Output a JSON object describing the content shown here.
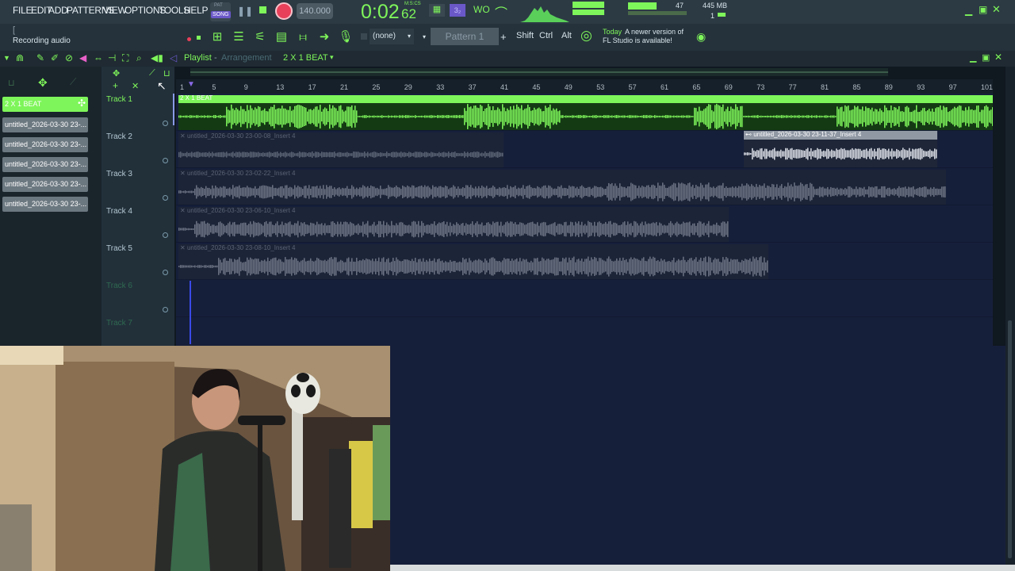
{
  "menu": [
    "FILE",
    "EDIT",
    "ADD",
    "PATTERNS",
    "VIEW",
    "OPTIONS",
    "TOOLS",
    "HELP"
  ],
  "transport": {
    "mode_top": "PAT",
    "mode_bottom": "SONG",
    "tempo": "140.000",
    "time": "0:02",
    "time_sub": "62",
    "time_label": "M:S:CS",
    "pattern_label": "Pattern 1",
    "snap_value": "(none)",
    "cpu": "47",
    "memory": "445 MB",
    "voices": "1"
  },
  "status": {
    "hint_top": "[",
    "hint_text": "Recording audio",
    "news_day": "Today",
    "news_text_1": "A newer version of",
    "news_text_2": "FL Studio is available!"
  },
  "keys": [
    "Shift",
    "Ctrl",
    "Alt"
  ],
  "playlist": {
    "title": "Playlist",
    "subtitle": "Arrangement",
    "pattern": "2 X 1 BEAT"
  },
  "pattern_list": [
    "2 X 1 BEAT",
    "untitled_2026-03-30 23-...",
    "untitled_2026-03-30 23-...",
    "untitled_2026-03-30 23-...",
    "untitled_2026-03-30 23-...",
    "untitled_2026-03-30 23-..."
  ],
  "tracks": [
    "Track 1",
    "Track 2",
    "Track 3",
    "Track 4",
    "Track 5",
    "Track 6",
    "Track 7"
  ],
  "ruler": [
    "1",
    "5",
    "9",
    "13",
    "17",
    "21",
    "25",
    "29",
    "33",
    "37",
    "41",
    "45",
    "49",
    "53",
    "57",
    "61",
    "65",
    "69",
    "73",
    "77",
    "81",
    "85",
    "89",
    "93",
    "97",
    "101"
  ],
  "clips": {
    "beat": "2 X 1 BEAT",
    "t2a": "untitled_2026-03-30 23-00-08_Insert 4",
    "t2b": "untitled_2026-03-30 23-11-37_Insert 4",
    "t3": "untitled_2026-03-30 23-02-22_Insert 4",
    "t4": "untitled_2026-03-30 23-06-10_Insert 4",
    "t5": "untitled_2026-03-30 23-08-10_Insert 4"
  },
  "colors": {
    "accent": "#7ef55a",
    "background": "#161f3a",
    "panel": "#22303a"
  }
}
